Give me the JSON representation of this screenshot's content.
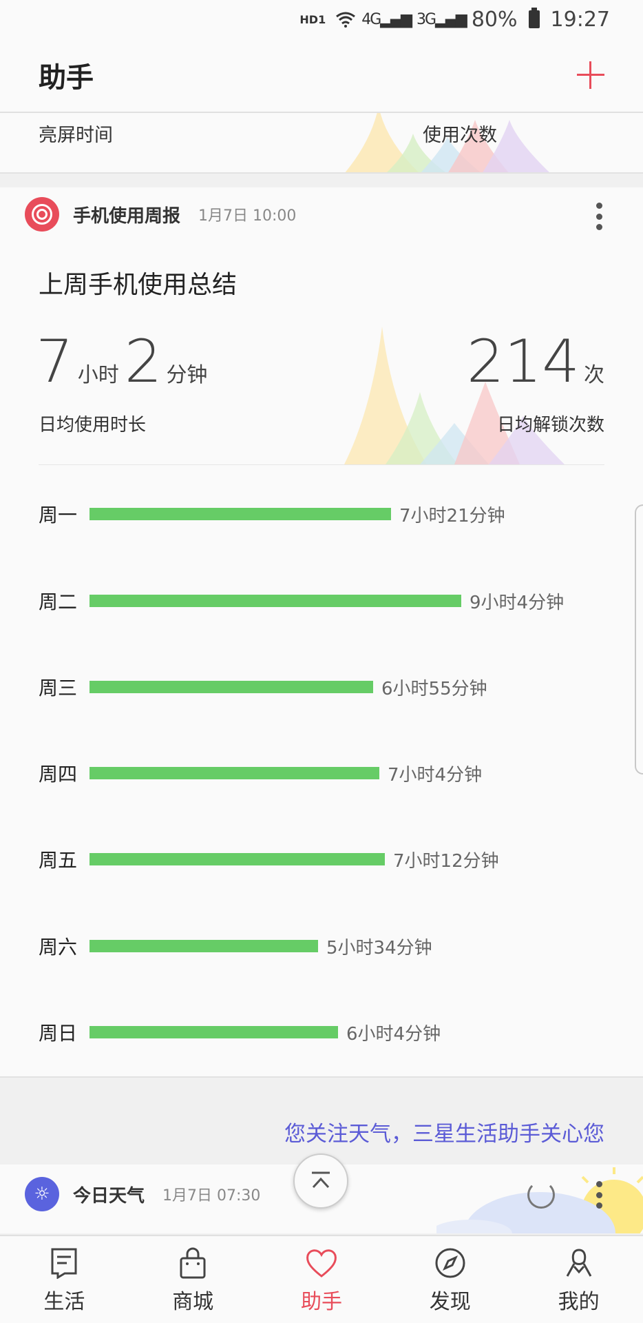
{
  "status_bar": {
    "hd": "HD1",
    "network1": "4G",
    "network2": "3G",
    "battery": "80%",
    "time": "19:27"
  },
  "header": {
    "title": "助手",
    "add_icon": "plus-icon"
  },
  "top_card": {
    "left_label": "亮屏时间",
    "right_label": "使用次数"
  },
  "report_card": {
    "name": "手机使用周报",
    "time": "1月7日 10:00",
    "title": "上周手机使用总结",
    "avg_hours": "7",
    "hours_unit": "小时",
    "avg_minutes": "2",
    "minutes_unit": "分钟",
    "avg_usage_label": "日均使用时长",
    "unlocks": "214",
    "unlocks_unit": "次",
    "avg_unlock_label": "日均解锁次数",
    "days": [
      {
        "label": "周一",
        "value": "7小时21分钟",
        "minutes": 441
      },
      {
        "label": "周二",
        "value": "9小时4分钟",
        "minutes": 544
      },
      {
        "label": "周三",
        "value": "6小时55分钟",
        "minutes": 415
      },
      {
        "label": "周四",
        "value": "7小时4分钟",
        "minutes": 424
      },
      {
        "label": "周五",
        "value": "7小时12分钟",
        "minutes": 432
      },
      {
        "label": "周六",
        "value": "5小时34分钟",
        "minutes": 334
      },
      {
        "label": "周日",
        "value": "6小时4分钟",
        "minutes": 364
      }
    ],
    "bar_color": "#66cc66"
  },
  "promo": "您关注天气，三星生活助手关心您",
  "weather_card": {
    "name": "今日天气",
    "time": "1月7日 07:30"
  },
  "bottom_nav": [
    {
      "label": "生活",
      "icon": "bookmark-icon"
    },
    {
      "label": "商城",
      "icon": "shopping-bag-icon"
    },
    {
      "label": "助手",
      "icon": "heart-icon",
      "active": true
    },
    {
      "label": "发现",
      "icon": "compass-icon"
    },
    {
      "label": "我的",
      "icon": "person-icon"
    }
  ],
  "colors": {
    "accent": "#e84c5a",
    "promo": "#5b5bd6",
    "weather": "#5a63de"
  }
}
